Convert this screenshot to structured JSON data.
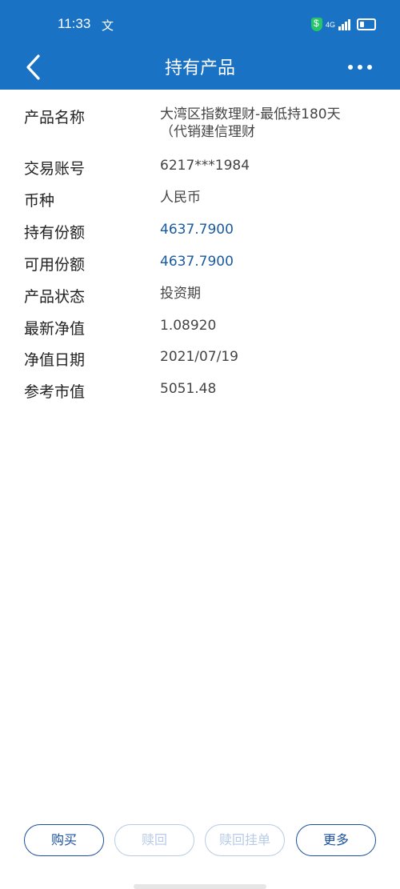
{
  "status_bar": {
    "time": "11:33",
    "extra": "文",
    "network": "4G"
  },
  "header": {
    "title": "持有产品"
  },
  "details": [
    {
      "label": "产品名称",
      "value_lines": [
        "大湾区指数理财-最低持180天",
        "（代销建信理财"
      ],
      "highlight": false
    },
    {
      "label": "交易账号",
      "value_lines": [
        "6217***1984"
      ],
      "highlight": false
    },
    {
      "label": "币种",
      "value_lines": [
        "人民币"
      ],
      "highlight": false
    },
    {
      "label": "持有份额",
      "value_lines": [
        "4637.7900"
      ],
      "highlight": true
    },
    {
      "label": "可用份额",
      "value_lines": [
        "4637.7900"
      ],
      "highlight": true
    },
    {
      "label": "产品状态",
      "value_lines": [
        "投资期"
      ],
      "highlight": false
    },
    {
      "label": "最新净值",
      "value_lines": [
        "1.08920"
      ],
      "highlight": false
    },
    {
      "label": "净值日期",
      "value_lines": [
        "2021/07/19"
      ],
      "highlight": false
    },
    {
      "label": "参考市值",
      "value_lines": [
        "5051.48"
      ],
      "highlight": false
    }
  ],
  "actions": {
    "buy": "购买",
    "redeem": "赎回",
    "redeem_order": "赎回挂单",
    "more": "更多"
  },
  "colors": {
    "header_bg": "#1a72c4",
    "accent_value": "#1a5a9e",
    "button_border": "#1a4f9c",
    "button_disabled": "#b8cbe6"
  }
}
